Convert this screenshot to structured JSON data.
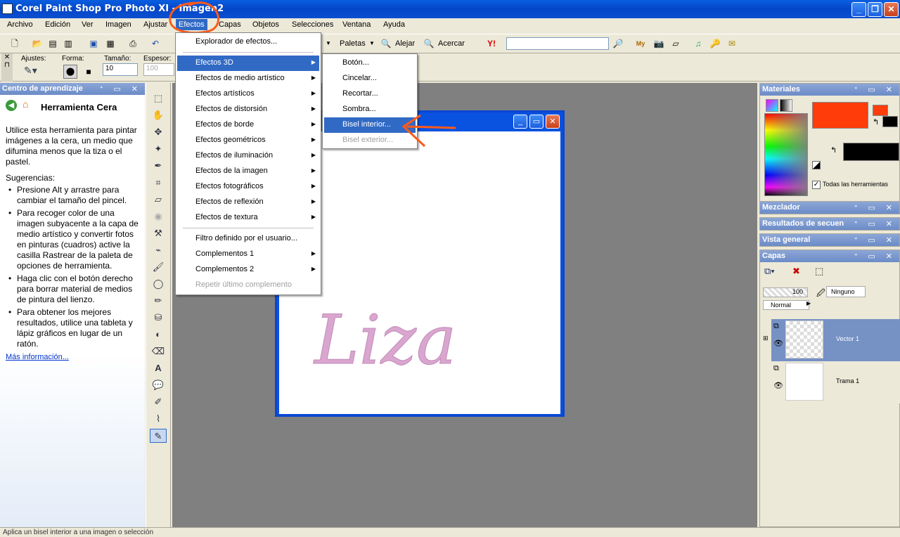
{
  "window": {
    "title": "Corel Paint Shop Pro Photo XI - Imagen2"
  },
  "menubar": [
    "Archivo",
    "Edición",
    "Ver",
    "Imagen",
    "Ajustar",
    "Efectos",
    "Capas",
    "Objetos",
    "Selecciones",
    "Ventana",
    "Ayuda"
  ],
  "toolbar": {
    "paletas": "Paletas",
    "alejar": "Alejar",
    "acercar": "Acercar"
  },
  "options": {
    "ajustes": "Ajustes:",
    "forma": "Forma:",
    "tamano_label": "Tamaño:",
    "tamano_value": "10",
    "espesor_label": "Espesor:",
    "espesor_value": "100"
  },
  "learning": {
    "panel_title": "Centro de aprendizaje",
    "heading": "Herramienta Cera",
    "intro": "Utilice esta herramienta para pintar imágenes a la cera, un medio que difumina menos que la tiza o el pastel.",
    "tips_title": "Sugerencias:",
    "tips": [
      "Presione Alt y arrastre para cambiar el tamaño del pincel.",
      "Para recoger color de una imagen subyacente a la capa de medio artístico y convertir fotos en pinturas (cuadros) active la casilla Rastrear de la paleta de opciones de herramienta.",
      "Haga clic con el botón derecho para borrar material de medios de pintura del lienzo.",
      "Para obtener los mejores resultados, utilice una tableta y lápiz gráficos en lugar de un ratón."
    ],
    "more_link": "Más información..."
  },
  "effects_menu": {
    "items": [
      "Explorador de efectos...",
      "Efectos 3D",
      "Efectos de medio artístico",
      "Efectos artísticos",
      "Efectos de distorsión",
      "Efectos de borde",
      "Efectos geométricos",
      "Efectos de iluminación",
      "Efectos de la imagen",
      "Efectos fotográficos",
      "Efectos de reflexión",
      "Efectos de textura",
      "Filtro definido por el usuario...",
      "Complementos 1",
      "Complementos 2",
      "Repetir último complemento"
    ]
  },
  "submenu_3d": {
    "items": [
      "Botón...",
      "Cincelar...",
      "Recortar...",
      "Sombra...",
      "Bisel interior...",
      "Bisel exterior..."
    ]
  },
  "canvas": {
    "text": "Liza",
    "text_color": "#d9a6cf"
  },
  "materials": {
    "title": "Materiales",
    "todas_label": "Todas las herramientas",
    "foreground_color": "#ff3c0a",
    "background_color": "#000000"
  },
  "panels": {
    "mezclador": "Mezclador",
    "resultados": "Resultados de secuen",
    "vista": "Vista general",
    "capas": "Capas"
  },
  "layers": {
    "opacity": "100",
    "ninguno": "Ninguno",
    "blend": "Normal",
    "items": [
      {
        "name": "Vector 1"
      },
      {
        "name": "Trama 1"
      }
    ]
  },
  "status": {
    "text": "Aplica un bisel interior a una imagen o selección"
  },
  "colors": {
    "accent": "#316ac5",
    "annotation": "#ff5a1a"
  }
}
